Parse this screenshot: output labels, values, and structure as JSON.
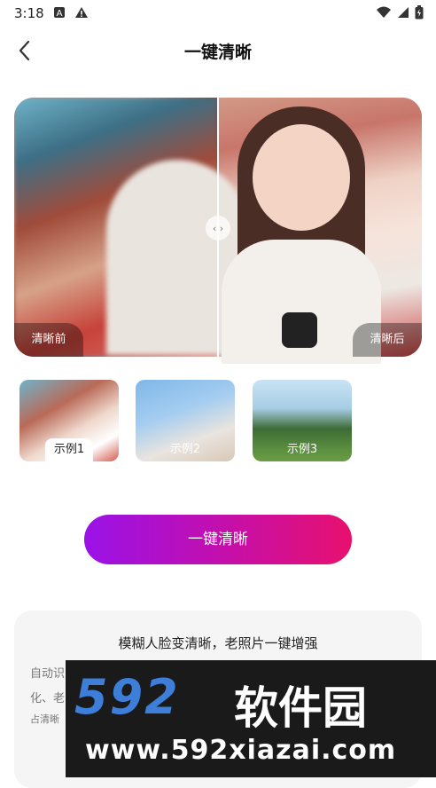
{
  "status_bar": {
    "time": "3:18",
    "left_icons": [
      "notification-a-icon",
      "warning-icon"
    ],
    "right_icons": [
      "wifi-icon",
      "signal-icon",
      "battery-icon"
    ]
  },
  "header": {
    "back_icon": "chevron-left-icon",
    "title": "一键清晰"
  },
  "compare": {
    "before_label": "清晰前",
    "after_label": "清晰后",
    "handle_glyph": "‹ ›"
  },
  "examples": [
    {
      "label": "示例1",
      "selected": true
    },
    {
      "label": "示例2",
      "selected": false
    },
    {
      "label": "示例3",
      "selected": false
    }
  ],
  "action": {
    "button_label": "一键清晰"
  },
  "info": {
    "title": "模糊人脸变清晰，老照片一键增强",
    "line1": "自动识",
    "line2": "化、老",
    "line3": "占清晰"
  },
  "watermark": {
    "number": "592",
    "name": "软件园",
    "url": "www.592xiazai.com"
  },
  "colors": {
    "button_start": "#9a12e8",
    "button_end": "#e8106e",
    "card_bg": "#f5f5f6"
  }
}
